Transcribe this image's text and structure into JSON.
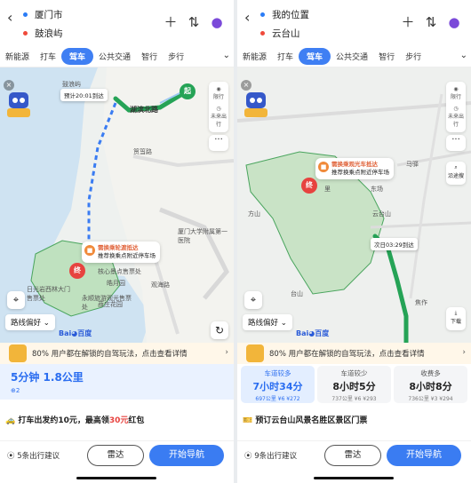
{
  "left": {
    "origin": "厦门市",
    "destination": "鼓浪屿",
    "tabs": [
      "新能源",
      "打车",
      "驾车",
      "公共交通",
      "智行",
      "步行"
    ],
    "active_tab": "驾车",
    "map": {
      "labels": [
        "鼓浪屿",
        "湖滨北路",
        "筼筜路",
        "厦门大学附属第一医院",
        "日光岩西林大门售票处",
        "菽庄花园",
        "皓月园",
        "核心景点售票处",
        "永顺旅游观光售票处",
        "观海路"
      ],
      "eta": "预计20:01到达",
      "bubble_title": "需换乘轮渡抵达",
      "bubble_sub": "推荐换乘点附近停车场",
      "start_label": "起",
      "end_label": "终"
    },
    "side_tools": [
      "限行",
      "未来出行"
    ],
    "route_pref": "路线偏好",
    "promo": "80% 用户都在解锁的自驾玩法，点击查看详情",
    "route_time": "5分钟",
    "route_distance": "1.8公里",
    "route_sub": "红绿灯2",
    "info": "打车出发约10元，最高领30元红包",
    "info_prefix": "打车出发约10元，最高领",
    "info_highlight": "30元",
    "info_suffix": "红包",
    "suggest": "5条出行建议",
    "radar": "雷达",
    "navigate": "开始导航"
  },
  "right": {
    "origin": "我的位置",
    "destination": "云台山",
    "tabs": [
      "新能源",
      "打车",
      "驾车",
      "公共交通",
      "智行",
      "步行"
    ],
    "active_tab": "驾车",
    "map": {
      "labels": [
        "云台山",
        "马驿",
        "东场",
        "方山",
        "台山",
        "里",
        "焦作"
      ],
      "eta": "次日03:29到达",
      "bubble_title": "需换乘观光车抵达",
      "bubble_sub": "推荐换乘点附近停车场",
      "end_label": "终"
    },
    "side_tools": [
      "限行",
      "未来出行"
    ],
    "search_route": "沿途搜",
    "download": "下载",
    "route_pref": "路线偏好",
    "promo": "80% 用户都在解锁的自驾玩法，点击查看详情",
    "options": [
      {
        "tag": "车道较多",
        "time": "7小时34分",
        "sub": "697公里 ¥6 ¥272"
      },
      {
        "tag": "车道较少",
        "time": "8小时5分",
        "sub": "737公里 ¥6 ¥293"
      },
      {
        "tag": "收费多",
        "time": "8小时8分",
        "sub": "736公里 ¥3 ¥294"
      }
    ],
    "info": "预订云台山风景名胜区景区门票",
    "suggest": "9条出行建议",
    "radar": "雷达",
    "navigate": "开始导航"
  },
  "colors": {
    "accent": "#3a7cf2",
    "route_green": "#25a356",
    "highlight_red": "#e7433f"
  }
}
